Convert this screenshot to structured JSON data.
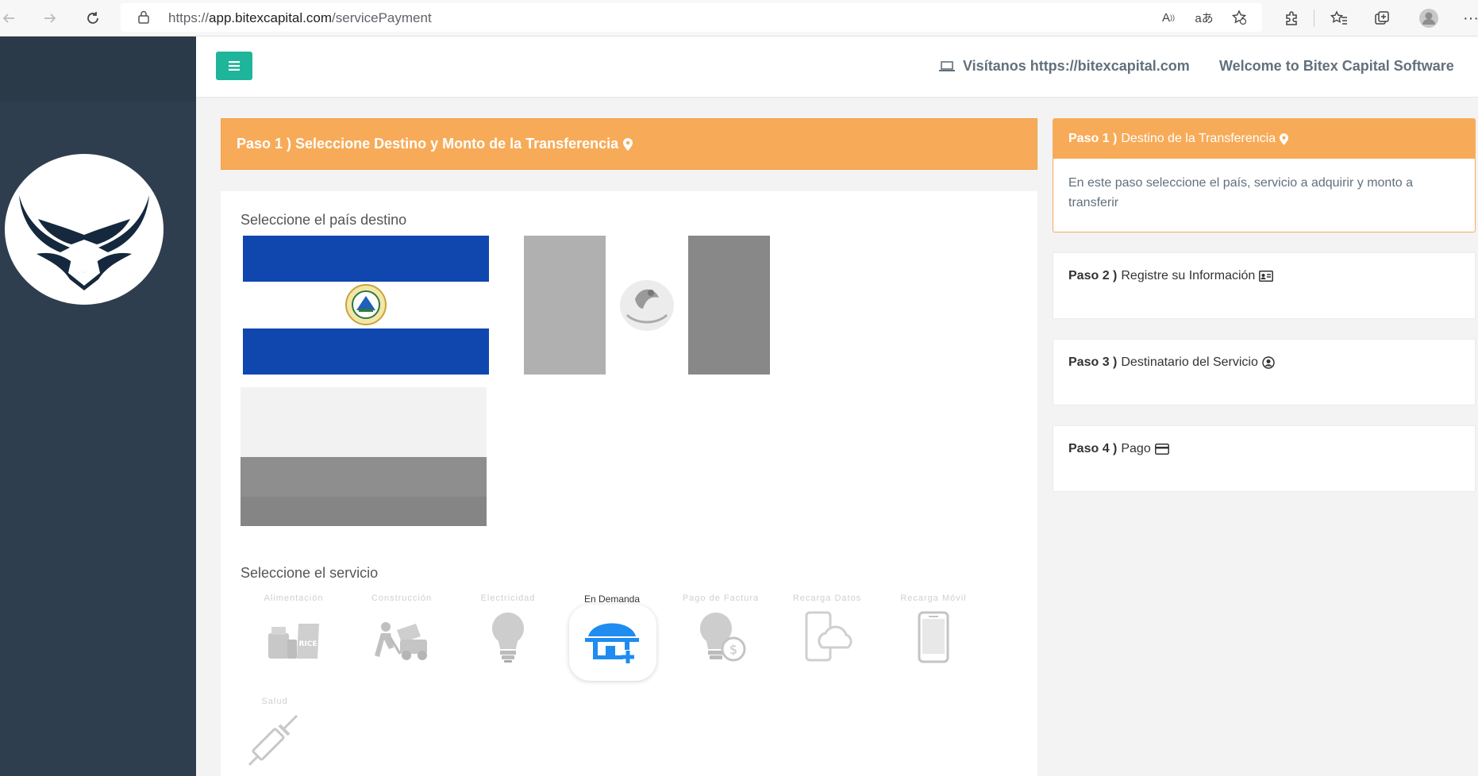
{
  "browser": {
    "url_prefix": "https://",
    "url_host": "app.bitexcapital.com",
    "url_path": "/servicePayment"
  },
  "header": {
    "visit_text": "Visítanos https://bitexcapital.com",
    "welcome_text": "Welcome to Bitex Capital Software"
  },
  "main": {
    "step_title": "Paso 1 ) Seleccione Destino y Monto de la Transferencia",
    "country_title": "Seleccione el país destino",
    "service_title": "Seleccione el servicio",
    "services": [
      {
        "label": "Alimentación",
        "icon": "food-icon"
      },
      {
        "label": "Construcción",
        "icon": "construction-icon"
      },
      {
        "label": "Electricidad",
        "icon": "lightbulb-icon"
      },
      {
        "label": "En Demanda",
        "icon": "house-plus-icon"
      },
      {
        "label": "Pago de Factura",
        "icon": "bill-payment-icon"
      },
      {
        "label": "Recarga Datos",
        "icon": "cloud-phone-icon"
      },
      {
        "label": "Recarga Móvil",
        "icon": "mobile-phone-icon"
      },
      {
        "label": "Salud",
        "icon": "syringe-icon"
      }
    ]
  },
  "steps": {
    "step1": {
      "num": "Paso 1 )",
      "label": "Destino de la Transferencia",
      "body": "En este paso seleccione el país, servicio a adquirir y monto a transferir"
    },
    "step2": {
      "num": "Paso 2 )",
      "label": "Registre su Información"
    },
    "step3": {
      "num": "Paso 3 )",
      "label": "Destinatario del Servicio"
    },
    "step4": {
      "num": "Paso 4 )",
      "label": "Pago"
    }
  },
  "colors": {
    "orange": "#f7ab58",
    "teal": "#1fb59a",
    "sidebar": "#2e3e4e",
    "active_blue": "#1e8cf0"
  }
}
